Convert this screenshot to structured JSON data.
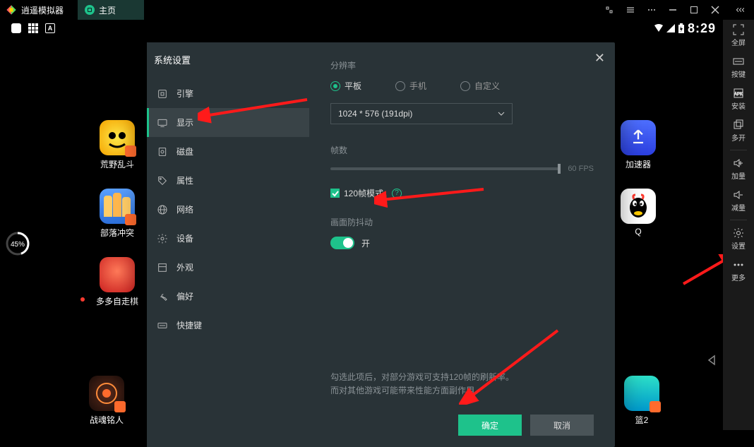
{
  "title_bar": {
    "app_name": "逍遥模拟器",
    "tab_label": "主页"
  },
  "status": {
    "time": "8:29",
    "a_label": "A"
  },
  "progress": {
    "pct": "45%"
  },
  "right_tools": {
    "fullscreen": "全屏",
    "keys": "按键",
    "install": "安装",
    "multi": "多开",
    "vol_up": "加量",
    "vol_down": "减量",
    "settings": "设置",
    "more": "更多"
  },
  "apps": {
    "a1": "荒野乱斗",
    "a2": "部落冲突",
    "a3": "多多自走棋",
    "r1": "加速器",
    "r2": "Q",
    "b1": "战魂铭人",
    "b2": "篮2"
  },
  "modal": {
    "title": "系统设置",
    "sidebar": {
      "engine": "引擎",
      "display": "显示",
      "disk": "磁盘",
      "attr": "属性",
      "network": "网络",
      "device": "设备",
      "appearance": "外观",
      "pref": "偏好",
      "shortcut": "快捷键"
    },
    "resolution": {
      "label": "分辨率",
      "tablet": "平板",
      "phone": "手机",
      "custom": "自定义",
      "value": "1024 * 576 (191dpi)"
    },
    "fps": {
      "label": "帧数",
      "value": "60 FPS",
      "mode120": "120帧模式"
    },
    "anti_shake": {
      "label": "画面防抖动",
      "state": "开"
    },
    "hint1": "勾选此项后，对部分游戏可支持120帧的刷新率。",
    "hint2": "而对其他游戏可能带来性能方面副作用。",
    "ok": "确定",
    "cancel": "取消"
  }
}
